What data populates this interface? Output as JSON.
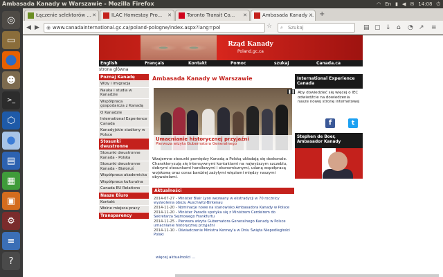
{
  "window": {
    "title": "Ambasada Kanady w Warszawie - Mozilla Firefox"
  },
  "tray": {
    "time": "14:08",
    "icons": [
      "wifi-icon",
      "input-en-icon",
      "battery-icon",
      "volume-icon",
      "mail-icon"
    ]
  },
  "tabs": [
    {
      "label": "Łączenie selektorów ...",
      "icon": "puzzle-icon"
    },
    {
      "label": "ILAC Homestay Pro...",
      "icon": "flag-icon"
    },
    {
      "label": "Toronto Transit Co...",
      "icon": "ttc-icon"
    },
    {
      "label": "Ambasada Kanady ...",
      "icon": "flag-icon",
      "active": true
    }
  ],
  "nav": {
    "url": "www.canadainternational.gc.ca/poland-pologne/index.aspx?lang=pol",
    "search_placeholder": "Szukaj"
  },
  "launcher": [
    "ubuntu-dash-icon",
    "files-icon",
    "firefox-icon",
    "gimp-icon",
    "terminal-icon",
    "virtualbox-icon",
    "chromium-icon",
    "writer-icon",
    "calc-icon",
    "impress-icon",
    "settings-icon",
    "stack-icon",
    "help-icon",
    "trash-icon"
  ],
  "banner": {
    "title": "Rząd Kanady",
    "subtitle": "Poland.gc.ca"
  },
  "main_nav": [
    "English",
    "Français",
    "Kontakt",
    "Pomoc",
    "szukaj",
    "Canada.ca"
  ],
  "breadcrumb": "strona główna",
  "sidebar": [
    {
      "header": "Poznaj Kanadę",
      "items": [
        "Wizy i imigracja",
        "Nauka i studia w Kanadzie",
        "Współpraca gospodarcza z Kanadą",
        "O Kanadzie",
        "International Experience Canada",
        "Kanadyjskie stadiony w Polsce"
      ]
    },
    {
      "header": "Stosunki dwustronne",
      "items": [
        "Stosunki dwustronne Kanada - Polska",
        "Stosunki dwustronne Kanada - Białoruś",
        "Współpraca akademicka",
        "Współpraca kulturalna",
        "Canada EU Relations"
      ]
    },
    {
      "header": "Nasze Biuro",
      "items": [
        "Kontakt",
        "Wolne miejsca pracy"
      ]
    },
    {
      "header": "Transparency",
      "items": []
    }
  ],
  "main": {
    "heading": "Ambasada Kanady w Warszawie",
    "hero_controls": "❚❚ 1 2",
    "caption_title": "Umacnianie historycznej przyjaźni",
    "caption_sub": "Pierwsza wizyta Gubernatora Generalnego",
    "intro": "Wzajemne stosunki pomiędzy Kanadą a Polską układają się doskonale. Charakteryzują się intensywnymi kontaktami na najwyższym szczeblu, dobrymi stosunkami handlowymi i ekonomicznymi, udaną współpracą wojskową oraz coraz bardziej zażyłymi więziami między naszymi obywatelami.",
    "news_header": "Aktualności",
    "news": [
      {
        "date": "2014-07-27 -",
        "text": "Minister Blair Lyon wezwany w ekstradycji w 70 rocznicy wyzwolenia obozu Auschwitz-Birkenau"
      },
      {
        "date": "2014-11-20 -",
        "text": "Nominacje nowe na stanowisko Ambasadora Kanady w Polsce"
      },
      {
        "date": "2014-11-20 -",
        "text": "Minister Paradis spotyka się z Ministrem Cerdeirem do Sekretarza Sejmowego Frankfurtu"
      },
      {
        "date": "2014-11-25 -",
        "text": "Pierwsza wizyta Gubernatora Generalnego Kanady w Polsce umacnianie historycznej przyjaźni"
      },
      {
        "date": "2014-11-10 -",
        "text": "Oświadczenie Ministra Kenney'a w Dniu Święta Niepodległości Polski"
      }
    ],
    "more_news": "więcej aktualności ..."
  },
  "right": {
    "box_title": "International Experience Canada",
    "box_text": "Aby dowiedzieć się więcej o IEC odwiedźcie na dowiedzenia nasze nowej stronę internetowej",
    "ambassador_title": "Stephen de Boer, Ambasador Kanady"
  }
}
